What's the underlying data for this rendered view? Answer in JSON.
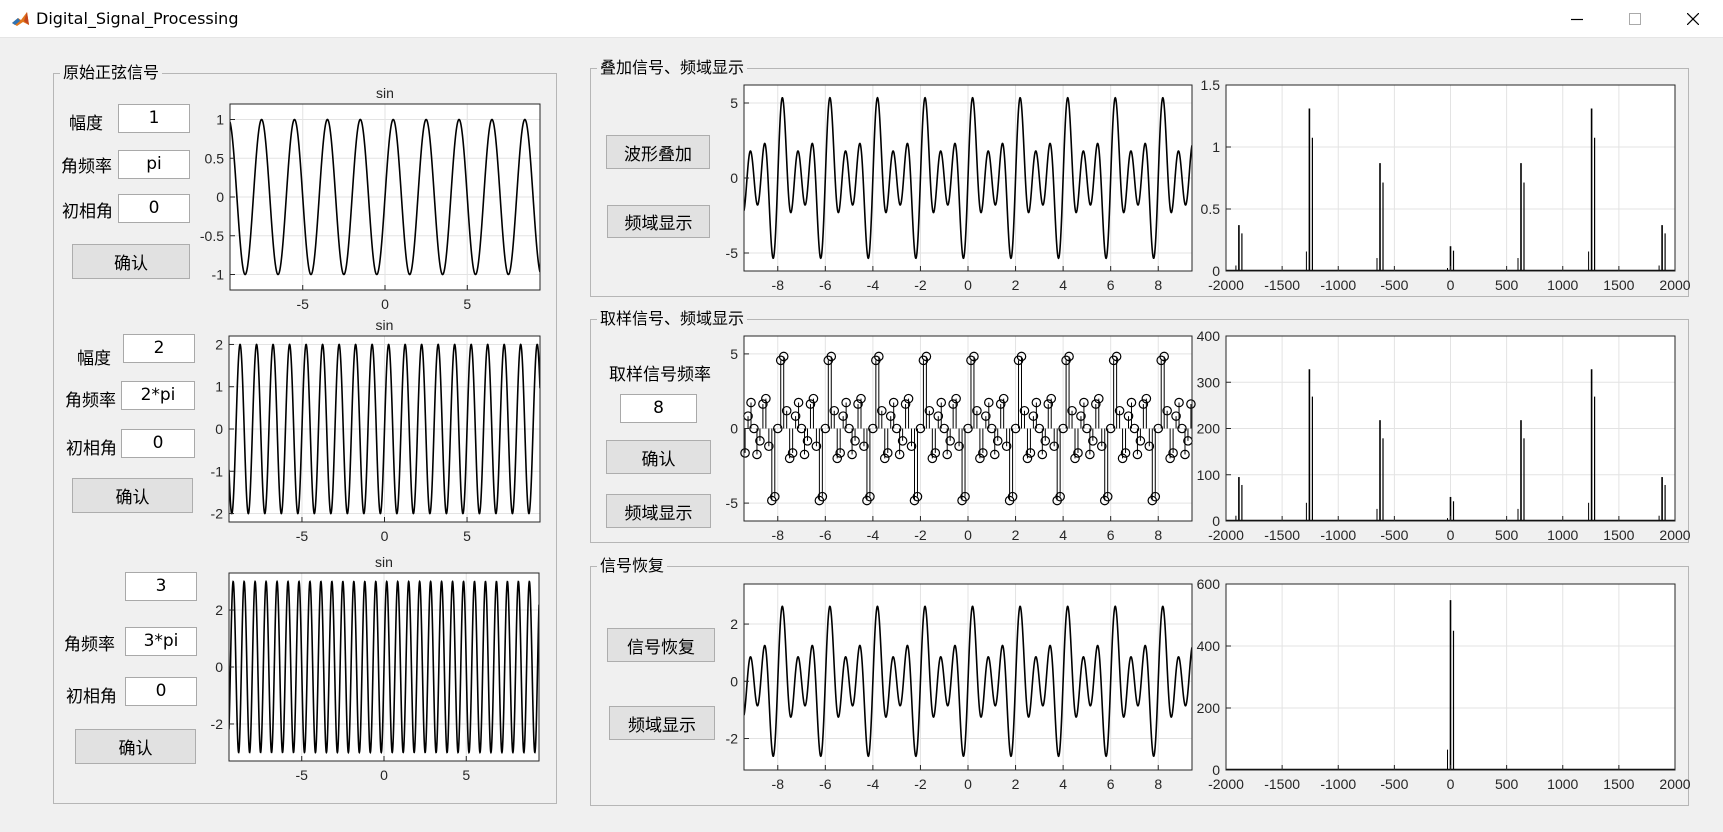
{
  "window": {
    "title": "Digital_Signal_Processing",
    "icon": "matlab-icon",
    "controls": [
      "minimize-icon",
      "maximize-icon",
      "close-icon"
    ]
  },
  "left_panel": {
    "title": "原始正弦信号",
    "signals": [
      {
        "amplitude_label": "幅度",
        "amplitude_value": "1",
        "freq_label": "角频率",
        "freq_value": "pi",
        "phase_label": "初相角",
        "phase_value": "0",
        "confirm_label": "确认"
      },
      {
        "amplitude_label": "幅度",
        "amplitude_value": "2",
        "freq_label": "角频率",
        "freq_value": "2*pi",
        "phase_label": "初相角",
        "phase_value": "0",
        "confirm_label": "确认"
      },
      {
        "amplitude_label": "",
        "amplitude_value": "3",
        "freq_label": "角频率",
        "freq_value": "3*pi",
        "phase_label": "初相角",
        "phase_value": "0",
        "confirm_label": "确认"
      }
    ]
  },
  "superpose_panel": {
    "title": "叠加信号、频域显示",
    "superpose_label": "波形叠加",
    "freq_display_label": "频域显示"
  },
  "sampling_panel": {
    "title": "取样信号、频域显示",
    "rate_label": "取样信号频率",
    "rate_value": "8",
    "confirm_label": "确认",
    "freq_display_label": "频域显示"
  },
  "recovery_panel": {
    "title": "信号恢复",
    "recover_label": "信号恢复",
    "freq_display_label": "频域显示"
  },
  "chart_data": [
    {
      "id": "sin1",
      "type": "line",
      "title": "sin",
      "x_range": [
        -9.42,
        9.42
      ],
      "ylim": [
        -1.2,
        1.2
      ],
      "xticks": [
        -5,
        0,
        5
      ],
      "yticks": [
        -1,
        -0.5,
        0,
        0.5,
        1
      ],
      "xtick_labels": [
        "-5",
        "0",
        "5"
      ],
      "ytick_labels": [
        "-1",
        "-0.5",
        "0",
        "0.5",
        "1"
      ],
      "signal": {
        "A": 1,
        "w": 3.14159,
        "phi": 0
      },
      "grid": true
    },
    {
      "id": "sin2",
      "type": "line",
      "title": "sin",
      "x_range": [
        -9.42,
        9.42
      ],
      "ylim": [
        -2.2,
        2.2
      ],
      "xticks": [
        -5,
        0,
        5
      ],
      "yticks": [
        -2,
        -1,
        0,
        1,
        2
      ],
      "xtick_labels": [
        "-5",
        "0",
        "5"
      ],
      "ytick_labels": [
        "-2",
        "-1",
        "0",
        "1",
        "2"
      ],
      "signal": {
        "A": 2,
        "w": 6.28318,
        "phi": 0
      },
      "grid": true
    },
    {
      "id": "sin3",
      "type": "line",
      "title": "sin",
      "x_range": [
        -9.42,
        9.42
      ],
      "ylim": [
        -3.3,
        3.3
      ],
      "xticks": [
        -5,
        0,
        5
      ],
      "yticks": [
        -2,
        0,
        2
      ],
      "xtick_labels": [
        "-5",
        "0",
        "5"
      ],
      "ytick_labels": [
        "-2",
        "0",
        "2"
      ],
      "signal": {
        "A": 3,
        "w": 9.42478,
        "phi": 0
      },
      "grid": true
    },
    {
      "id": "sum",
      "type": "line",
      "title": "",
      "x_range": [
        -9.42,
        9.42
      ],
      "ylim": [
        -6.2,
        6.2
      ],
      "xticks": [
        -8,
        -6,
        -4,
        -2,
        0,
        2,
        4,
        6,
        8
      ],
      "yticks": [
        -5,
        0,
        5
      ],
      "xtick_labels": [
        "-8",
        "-6",
        "-4",
        "-2",
        "0",
        "2",
        "4",
        "6",
        "8"
      ],
      "ytick_labels": [
        "-5",
        "0",
        "5"
      ],
      "grid": true
    },
    {
      "id": "sum_spec",
      "type": "line",
      "title": "",
      "xlim": [
        -2000,
        2000
      ],
      "ylim": [
        0,
        1.5
      ],
      "xticks": [
        -2000,
        -1500,
        -1000,
        -500,
        0,
        500,
        1000,
        1500,
        2000
      ],
      "yticks": [
        0,
        0.5,
        1,
        1.5
      ],
      "xtick_labels": [
        "-2000",
        "-1500",
        "-1000",
        "-500",
        "0",
        "500",
        "1000",
        "1500",
        "2000"
      ],
      "ytick_labels": [
        "0",
        "0.5",
        "1",
        "1.5"
      ],
      "peaks": [
        {
          "x": -1885,
          "y": 0.37
        },
        {
          "x": -1257,
          "y": 1.31
        },
        {
          "x": -628,
          "y": 0.87
        },
        {
          "x": 0,
          "y": 0.2
        },
        {
          "x": 628,
          "y": 0.87
        },
        {
          "x": 1257,
          "y": 1.31
        },
        {
          "x": 1885,
          "y": 0.37
        }
      ],
      "grid": true
    },
    {
      "id": "sampled",
      "type": "stem",
      "title": "",
      "x_range": [
        -9.42,
        9.42
      ],
      "ylim": [
        -6.2,
        6.2
      ],
      "sample_rate": 8,
      "xticks": [
        -8,
        -6,
        -4,
        -2,
        0,
        2,
        4,
        6,
        8
      ],
      "yticks": [
        -5,
        0,
        5
      ],
      "xtick_labels": [
        "-8",
        "-6",
        "-4",
        "-2",
        "0",
        "2",
        "4",
        "6",
        "8"
      ],
      "ytick_labels": [
        "-5",
        "0",
        "5"
      ],
      "grid": true
    },
    {
      "id": "sampled_spec",
      "type": "line",
      "title": "",
      "xlim": [
        -2000,
        2000
      ],
      "ylim": [
        0,
        400
      ],
      "xticks": [
        -2000,
        -1500,
        -1000,
        -500,
        0,
        500,
        1000,
        1500,
        2000
      ],
      "yticks": [
        0,
        100,
        200,
        300,
        400
      ],
      "xtick_labels": [
        "-2000",
        "-1500",
        "-1000",
        "-500",
        "0",
        "500",
        "1000",
        "1500",
        "2000"
      ],
      "ytick_labels": [
        "0",
        "100",
        "200",
        "300",
        "400"
      ],
      "peaks": [
        {
          "x": -1885,
          "y": 95
        },
        {
          "x": -1257,
          "y": 328
        },
        {
          "x": -628,
          "y": 218
        },
        {
          "x": 0,
          "y": 52
        },
        {
          "x": 628,
          "y": 218
        },
        {
          "x": 1257,
          "y": 328
        },
        {
          "x": 1885,
          "y": 95
        }
      ],
      "grid": true
    },
    {
      "id": "recovered",
      "type": "line",
      "title": "",
      "x_range": [
        -9.42,
        9.42
      ],
      "ylim": [
        -3.1,
        3.4
      ],
      "xticks": [
        -8,
        -6,
        -4,
        -2,
        0,
        2,
        4,
        6,
        8
      ],
      "yticks": [
        -2,
        0,
        2
      ],
      "xtick_labels": [
        "-8",
        "-6",
        "-4",
        "-2",
        "0",
        "2",
        "4",
        "6",
        "8"
      ],
      "ytick_labels": [
        "-2",
        "0",
        "2"
      ],
      "grid": true
    },
    {
      "id": "recovered_spec",
      "type": "line",
      "title": "",
      "xlim": [
        -2000,
        2000
      ],
      "ylim": [
        0,
        600
      ],
      "xticks": [
        -2000,
        -1500,
        -1000,
        -500,
        0,
        500,
        1000,
        1500,
        2000
      ],
      "yticks": [
        0,
        200,
        400,
        600
      ],
      "xtick_labels": [
        "-2000",
        "-1500",
        "-1000",
        "-500",
        "0",
        "500",
        "1000",
        "1500",
        "2000"
      ],
      "ytick_labels": [
        "0",
        "200",
        "400",
        "600"
      ],
      "peaks": [
        {
          "x": 0,
          "y": 548
        }
      ],
      "grid": true
    }
  ]
}
